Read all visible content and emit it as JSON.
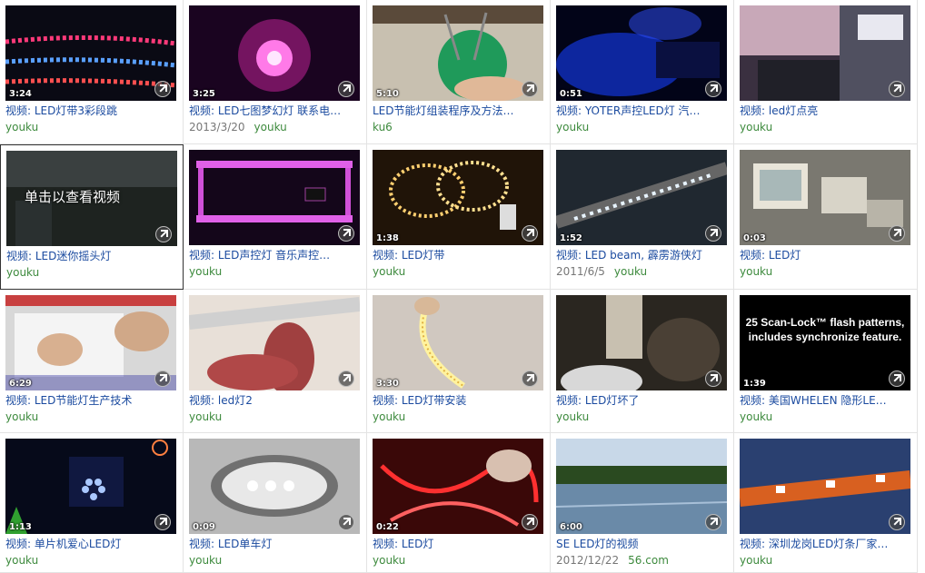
{
  "results": [
    {
      "title": "视频: LED灯带3彩段跳",
      "duration": "3:24",
      "date": "",
      "source": "youku"
    },
    {
      "title": "视频: LED七图梦幻灯 联系电…",
      "duration": "3:25",
      "date": "2013/3/20",
      "source": "youku"
    },
    {
      "title": "LED节能灯组装程序及方法…",
      "duration": "5:10",
      "date": "",
      "source": "ku6"
    },
    {
      "title": "视频: YOTER声控LED灯 汽…",
      "duration": "0:51",
      "date": "",
      "source": "youku"
    },
    {
      "title": "视频: led灯点亮",
      "duration": "",
      "date": "",
      "source": "youku"
    },
    {
      "title": "视频: LED迷你摇头灯",
      "duration": "",
      "date": "",
      "source": "youku",
      "overlay": "单击以查看视频"
    },
    {
      "title": "视频: LED声控灯 音乐声控…",
      "duration": "",
      "date": "",
      "source": "youku"
    },
    {
      "title": "视频: LED灯带",
      "duration": "1:38",
      "date": "",
      "source": "youku"
    },
    {
      "title": "视频: LED beam, 霹雳游侠灯",
      "duration": "1:52",
      "date": "2011/6/5",
      "source": "youku"
    },
    {
      "title": "视频: LED灯",
      "duration": "0:03",
      "date": "",
      "source": "youku"
    },
    {
      "title": "视频: LED节能灯生产技术",
      "duration": "6:29",
      "date": "",
      "source": "youku"
    },
    {
      "title": "视频: led灯2",
      "duration": "",
      "date": "",
      "source": "youku"
    },
    {
      "title": "视频: LED灯带安装",
      "duration": "3:30",
      "date": "",
      "source": "youku"
    },
    {
      "title": "视频: LED灯坏了",
      "duration": "",
      "date": "",
      "source": "youku"
    },
    {
      "title": "视频: 美国WHELEN 隐形LE…",
      "duration": "1:39",
      "date": "",
      "source": "youku",
      "overlay": "25 Scan-Lock™ flash patterns, includes synchronize feature."
    },
    {
      "title": "视频: 单片机爱心LED灯",
      "duration": "1:13",
      "date": "",
      "source": "youku"
    },
    {
      "title": "视频: LED单车灯",
      "duration": "0:09",
      "date": "",
      "source": "youku"
    },
    {
      "title": "视频: LED灯",
      "duration": "0:22",
      "date": "",
      "source": "youku"
    },
    {
      "title": "SE LED灯的视频",
      "duration": "6:00",
      "date": "2012/12/22",
      "source": "56.com"
    },
    {
      "title": "视频: 深圳龙岗LED灯条厂家…",
      "duration": "",
      "date": "",
      "source": "youku"
    }
  ],
  "colors": {
    "title": "#1a4a9f",
    "source": "#3d8a3d",
    "date": "#777777"
  }
}
